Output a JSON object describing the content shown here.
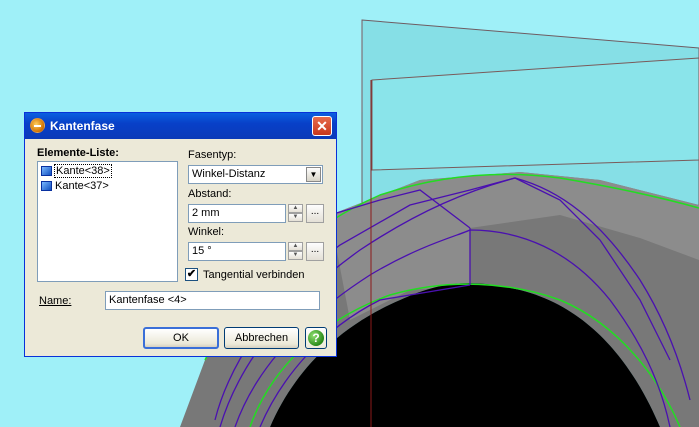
{
  "dialog": {
    "title": "Kantenfase",
    "close_symbol": "✕",
    "elements_list_label": "Elemente-Liste:",
    "elements": [
      {
        "label": "Kante<38>",
        "icon": "edge-icon"
      },
      {
        "label": "Kante<37>",
        "icon": "edge-icon"
      }
    ],
    "fasentyp_label": "Fasentyp:",
    "fasentyp_value": "Winkel-Distanz",
    "abstand_label": "Abstand:",
    "abstand_value": "2 mm",
    "winkel_label": "Winkel:",
    "winkel_value": "15 °",
    "tangential_label": "Tangential verbinden",
    "tangential_checked": true,
    "name_label": "Name:",
    "name_value": "Kantenfase <4>",
    "ok_label": "OK",
    "cancel_label": "Abbrechen",
    "help_symbol": "?",
    "browse_symbol": "...",
    "check_symbol": "✔"
  },
  "colors": {
    "background": "#9ff0f8",
    "plane": "#88e0e8",
    "solid": "#7c7c7c",
    "edge_highlight": "#22dd22",
    "edge_selected": "#4010a0",
    "axis": "#8b1a1a",
    "titlebar": "#0a5fe0"
  }
}
